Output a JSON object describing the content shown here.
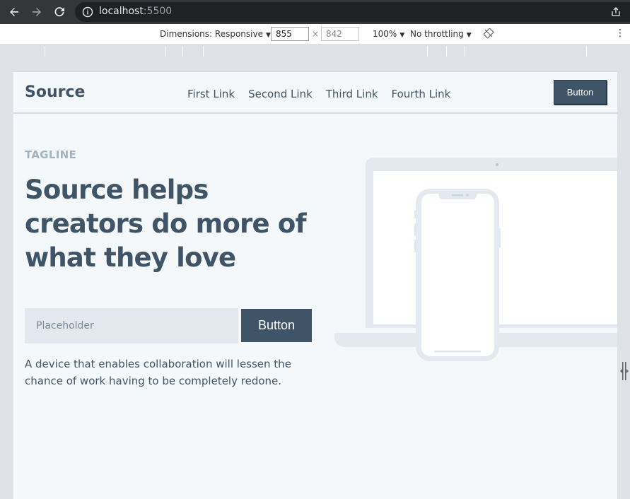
{
  "browser": {
    "url_host": "localhost",
    "url_port": ":5500"
  },
  "devtools": {
    "dimensions_label": "Dimensions: Responsive",
    "width": "855",
    "height": "842",
    "zoom": "100%",
    "throttling": "No throttling"
  },
  "site": {
    "logo": "Source",
    "nav": [
      "First Link",
      "Second Link",
      "Third Link",
      "Fourth Link"
    ],
    "header_button": "Button",
    "tagline": "TAGLINE",
    "headline": "Source helps creators do more of what they love",
    "input_placeholder": "Placeholder",
    "hero_button": "Button",
    "description": "A device that enables collaboration will lessen the chance of work having to be completely redone."
  },
  "colors": {
    "primary": "#3f5466",
    "tagline": "#9fb3c2",
    "background": "#f4f8fb",
    "input_bg": "#e2e8ee"
  }
}
